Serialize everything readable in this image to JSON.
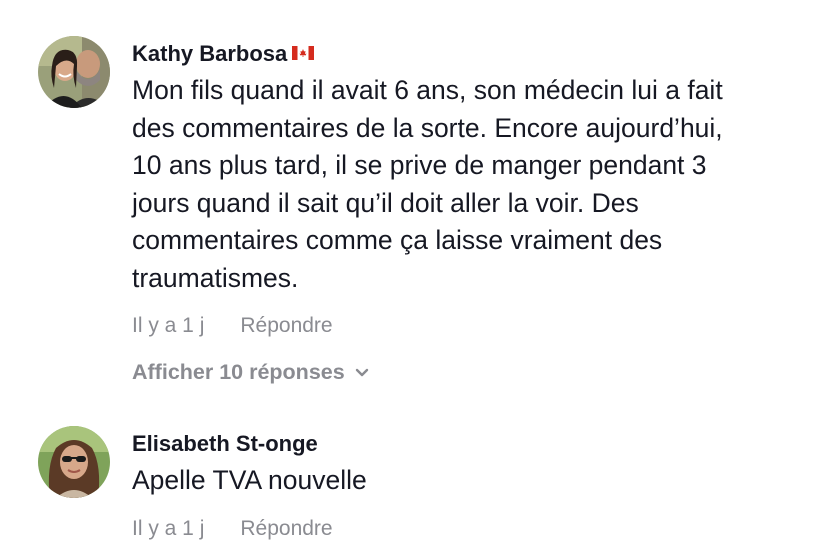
{
  "comments": [
    {
      "author": "Kathy Barbosa",
      "flag": "canada-flag-icon",
      "text": "Mon fils quand il avait 6 ans, son médecin lui a fait\ndes commentaires de la sorte. Encore aujourd’hui,\n10 ans plus tard, il se prive de manger pendant 3\njours quand il sait qu’il doit aller la voir. Des\ncommentaires comme ça laisse vraiment des\ntraumatismes.",
      "time": "Il y a 1 j",
      "reply_label": "Répondre",
      "view_replies_label": "Afficher 10 réponses"
    },
    {
      "author": "Elisabeth St-onge",
      "text": "Apelle TVA nouvelle",
      "time": "Il y a 1 j",
      "reply_label": "Répondre"
    }
  ],
  "colors": {
    "text": "#161823",
    "meta": "#8a8b91",
    "canada_red": "#d52b1e"
  }
}
